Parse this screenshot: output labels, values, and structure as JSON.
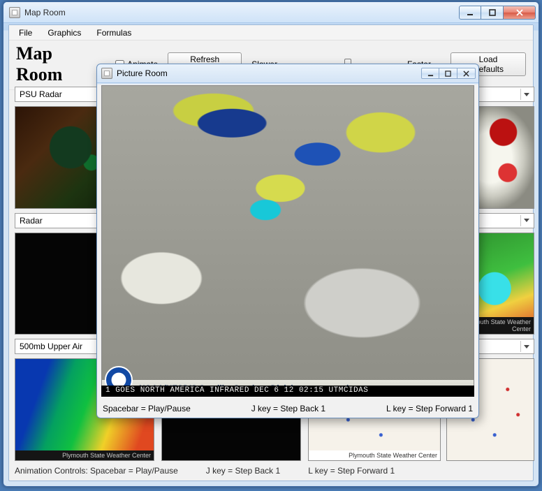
{
  "outer_window": {
    "title": "Map Room"
  },
  "menubar": [
    "File",
    "Graphics",
    "Formulas"
  ],
  "header": {
    "page_title": "Map Room",
    "animate_label": "Animate",
    "refresh_label": "Refresh Images",
    "slower_label": "Slower",
    "faster_label": "Faster",
    "load_defaults_label": "Load Defaults"
  },
  "columns": {
    "a": {
      "combos": [
        "PSU Radar",
        "Radar",
        "500mb Upper Air"
      ]
    },
    "d": {
      "combos": [
        "",
        "",
        ""
      ]
    }
  },
  "tile_caption": "Plymouth State Weather Center",
  "footer": {
    "controls": "Animation Controls: Spacebar = Play/Pause",
    "jkey": "J key =  Step Back 1",
    "lkey": "L key =  Step Forward 1"
  },
  "picture_room": {
    "title": "Picture Room",
    "noaa_text": "NOAA/NESDIS Satellite Services Division –  www.ssd.noaa.gov",
    "black_text": " 1   GOES NORTH AMERICA INFRARED DEC 6 12 02:15 UTMCIDAS",
    "footer_space": "Spacebar = Play/Pause",
    "footer_j": "J key = Step Back 1",
    "footer_l": "L key = Step Forward 1"
  }
}
